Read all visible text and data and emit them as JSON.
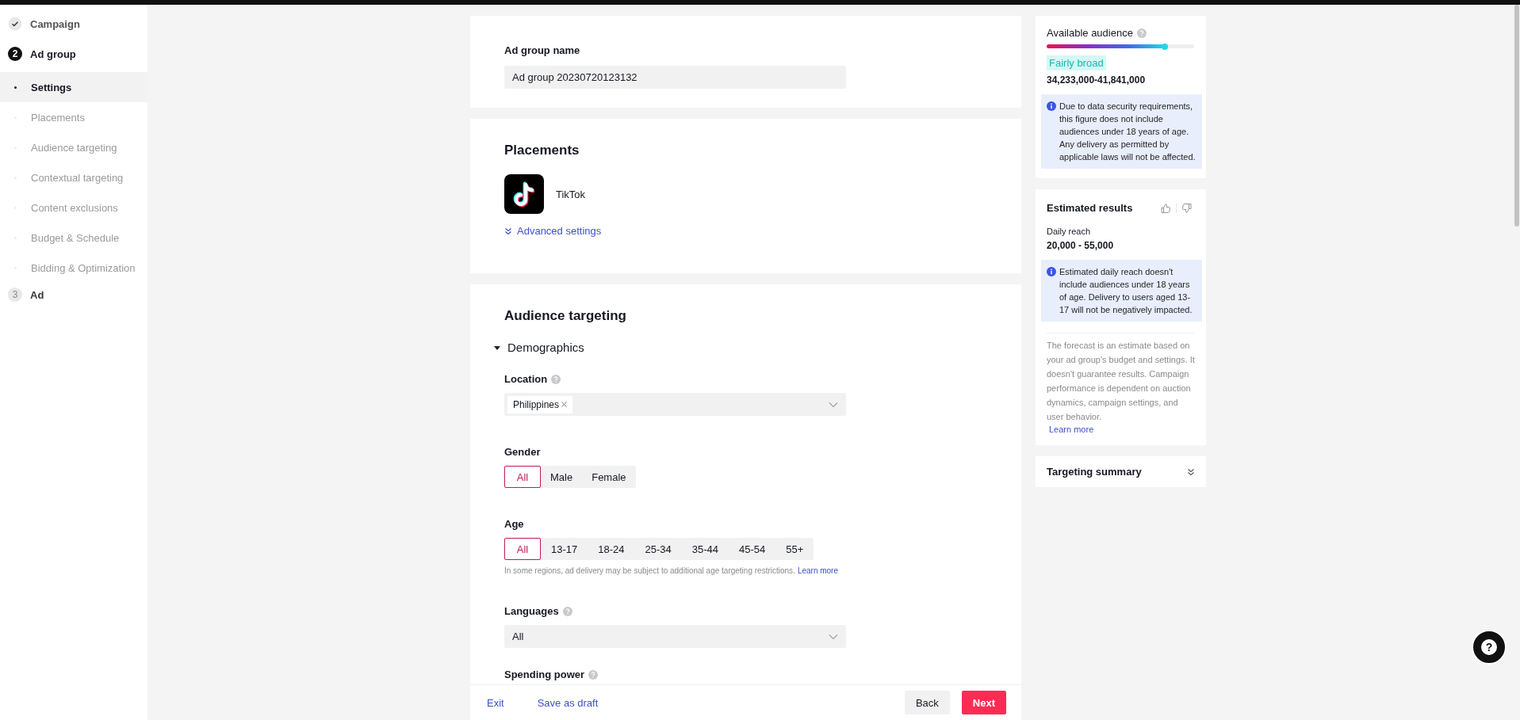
{
  "sidebar": {
    "steps": [
      {
        "label": "Campaign",
        "completed": true,
        "current": false
      },
      {
        "label": "Ad group",
        "completed": false,
        "current": true,
        "number": "2",
        "children": [
          {
            "label": "Settings",
            "selected": true
          },
          {
            "label": "Placements",
            "selected": false
          },
          {
            "label": "Audience targeting",
            "selected": false
          },
          {
            "label": "Contextual targeting",
            "selected": false
          },
          {
            "label": "Content exclusions",
            "selected": false
          },
          {
            "label": "Budget & Schedule",
            "selected": false
          },
          {
            "label": "Bidding & Optimization",
            "selected": false
          }
        ]
      },
      {
        "label": "Ad",
        "completed": false,
        "current": false,
        "number": "3"
      }
    ]
  },
  "ad_group_name": {
    "label": "Ad group name",
    "value": "Ad group 20230720123132"
  },
  "placements": {
    "title": "Placements",
    "items": [
      {
        "name": "TikTok"
      }
    ],
    "advanced_link": "Advanced settings"
  },
  "audience_targeting": {
    "title": "Audience targeting",
    "demographics": {
      "label": "Demographics",
      "expanded": true,
      "location": {
        "label": "Location",
        "tags": [
          "Philippines"
        ]
      },
      "gender": {
        "label": "Gender",
        "options": [
          {
            "label": "All",
            "selected": true
          },
          {
            "label": "Male",
            "selected": false
          },
          {
            "label": "Female",
            "selected": false
          }
        ]
      },
      "age": {
        "label": "Age",
        "options": [
          {
            "label": "All",
            "selected": true
          },
          {
            "label": "13-17",
            "selected": false
          },
          {
            "label": "18-24",
            "selected": false
          },
          {
            "label": "25-34",
            "selected": false
          },
          {
            "label": "35-44",
            "selected": false
          },
          {
            "label": "45-54",
            "selected": false
          },
          {
            "label": "55+",
            "selected": false
          }
        ],
        "note": "In some regions, ad delivery may be subject to additional age targeting restrictions.",
        "note_link": "Learn more"
      },
      "languages": {
        "label": "Languages",
        "value": "All"
      },
      "spending_power": {
        "label": "Spending power"
      }
    }
  },
  "footer": {
    "exit": "Exit",
    "save_draft": "Save as draft",
    "back": "Back",
    "next": "Next"
  },
  "available_audience": {
    "title": "Available audience",
    "level": 0.8,
    "rating": "Fairly broad",
    "range": "34,233,000-41,841,000",
    "info": "Due to data security requirements, this figure does not include audiences under 18 years of age. Any delivery as permitted by applicable laws will not be affected."
  },
  "estimated_results": {
    "title": "Estimated results",
    "daily_reach_label": "Daily reach",
    "daily_reach": "20,000 - 55,000",
    "info": "Estimated daily reach doesn't include audiences under 18 years of age. Delivery to users aged 13-17 will not be negatively impacted.",
    "disclaimer": "The forecast is an estimate based on your ad group's budget and settings. It doesn't guarantee results. Campaign performance is dependent on auction dynamics, campaign settings, and user behavior.",
    "learn_more": "Learn more"
  },
  "targeting_summary": {
    "title": "Targeting summary",
    "expanded": false
  },
  "help_button": "?"
}
